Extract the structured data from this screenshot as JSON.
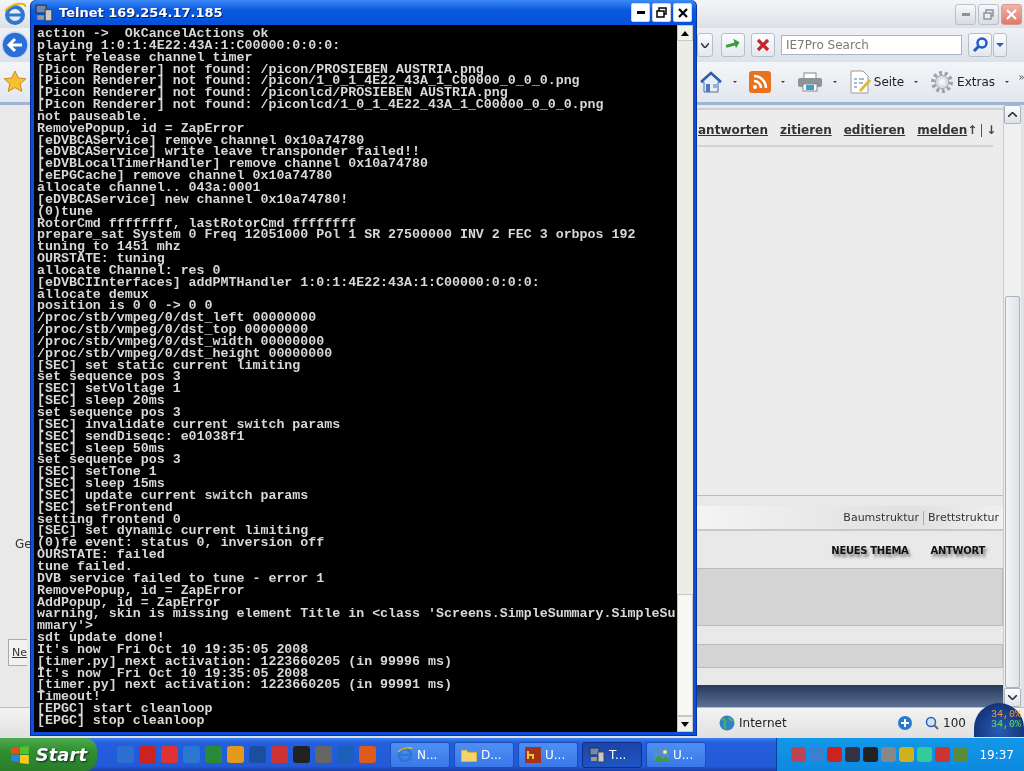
{
  "browser": {
    "search": {
      "placeholder": "IE7Pro Search"
    },
    "commands": [
      {
        "kind": "home"
      },
      {
        "kind": "feeds"
      },
      {
        "kind": "print"
      },
      {
        "kind": "page",
        "label": "Seite"
      },
      {
        "kind": "tools",
        "label": "Extras"
      }
    ],
    "left_labels": [
      {
        "kind": "text",
        "text": "Ge"
      },
      {
        "kind": "link",
        "text": "Ne"
      }
    ],
    "post_actions": [
      "antworten",
      "zitieren",
      "editieren",
      "melden"
    ],
    "nav_arrows": [
      "↑",
      "↓"
    ],
    "view_links": [
      "Baumstruktur",
      "Brettstruktur"
    ],
    "buttons": [
      "NEUES THEMA",
      "ANTWORT"
    ],
    "status": {
      "zone": "Internet",
      "zoom": "100"
    }
  },
  "meter": {
    "values": [
      "34,0%",
      "34,0%"
    ]
  },
  "telnet": {
    "title": "Telnet 169.254.17.185",
    "lines": [
      "action ->  OkCancelActions ok",
      "playing 1:0:1:4E22:43A:1:C00000:0:0:0:",
      "start release channel timer",
      "[Picon Renderer] not found: /picon/PROSIEBEN AUSTRIA.png",
      "[Picon Renderer] not found: /picon/1_0_1_4E22_43A_1_C00000_0_0_0.png",
      "[Picon Renderer] not found: /piconlcd/PROSIEBEN AUSTRIA.png",
      "[Picon Renderer] not found: /piconlcd/1_0_1_4E22_43A_1_C00000_0_0_0.png",
      "not pauseable.",
      "RemovePopup, id = ZapError",
      "[eDVBCAService] remove channel 0x10a74780",
      "[eDVBCAService] write leave transponder failed!!",
      "[eDVBLocalTimerHandler] remove channel 0x10a74780",
      "[eEPGCache] remove channel 0x10a74780",
      "allocate channel.. 043a:0001",
      "[eDVBCAService] new channel 0x10a74780!",
      "(0)tune",
      "RotorCmd ffffffff, lastRotorCmd ffffffff",
      "prepare_sat System 0 Freq 12051000 Pol 1 SR 27500000 INV 2 FEC 3 orbpos 192",
      "tuning to 1451 mhz",
      "OURSTATE: tuning",
      "allocate Channel: res 0",
      "[eDVBCIInterfaces] addPMTHandler 1:0:1:4E22:43A:1:C00000:0:0:0:",
      "allocate demux",
      "position is 0 0 -> 0 0",
      "/proc/stb/vmpeg/0/dst_left 00000000",
      "/proc/stb/vmpeg/0/dst_top 00000000",
      "/proc/stb/vmpeg/0/dst_width 00000000",
      "/proc/stb/vmpeg/0/dst_height 00000000",
      "[SEC] set static current limiting",
      "set sequence pos 3",
      "[SEC] setVoltage 1",
      "[SEC] sleep 20ms",
      "set sequence pos 3",
      "[SEC] invalidate current switch params",
      "[SEC] sendDiseqc: e01038f1",
      "[SEC] sleep 50ms",
      "set sequence pos 3",
      "[SEC] setTone 1",
      "[SEC] sleep 15ms",
      "[SEC] update current switch params",
      "[SEC] setFrontend",
      "setting frontend 0",
      "[SEC] set dynamic current limiting",
      "(0)fe event: status 0, inversion off",
      "OURSTATE: failed",
      "tune failed.",
      "DVB service failed to tune - error 1",
      "RemovePopup, id = ZapError",
      "AddPopup, id = ZapError",
      "warning, skin is missing element Title in <class 'Screens.SimpleSummary.SimpleSu",
      "mmary'>",
      "sdt update done!",
      "It's now  Fri Oct 10 19:35:05 2008",
      "[timer.py] next activation: 1223660205 (in 99996 ms)",
      "It's now  Fri Oct 10 19:35:05 2008",
      "[timer.py] next activation: 1223660205 (in 99991 ms)",
      "Timeout!",
      "[EPGC] start cleanloop",
      "[EPGC] stop cleanloop"
    ]
  },
  "taskbar": {
    "start": "Start",
    "tasks": [
      {
        "kind": "ie",
        "label": "N...",
        "selected": false
      },
      {
        "kind": "folder",
        "label": "D...",
        "selected": false
      },
      {
        "kind": "app",
        "label": "U...",
        "selected": false
      },
      {
        "kind": "telnet",
        "label": "T...",
        "selected": true
      },
      {
        "kind": "image",
        "label": "U...",
        "selected": false
      }
    ],
    "clock": "19:37"
  }
}
